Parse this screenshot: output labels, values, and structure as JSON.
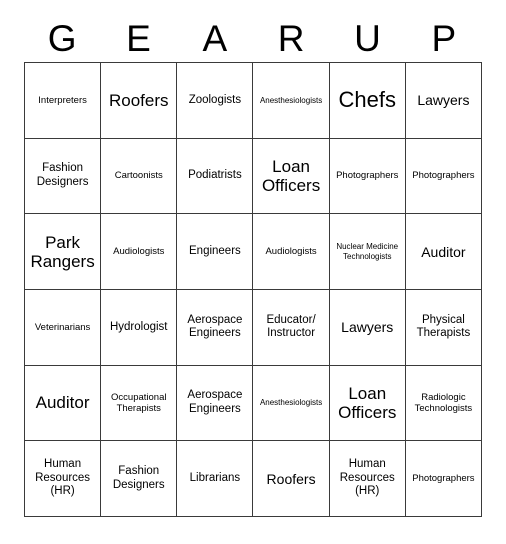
{
  "card": {
    "title": "GEAR UP",
    "header_letters": [
      "G",
      "E",
      "A",
      "R",
      "U",
      "P"
    ],
    "columns": 6,
    "rows": 6,
    "colors": {
      "background": "#ffffff",
      "grid_line": "#3a3a3a",
      "text": "#000000"
    },
    "cells": [
      [
        {
          "label": "Interpreters",
          "size": "sm"
        },
        {
          "label": "Roofers",
          "size": "xl"
        },
        {
          "label": "Zoologists",
          "size": "md"
        },
        {
          "label": "Anesthesiologists",
          "size": "xs"
        },
        {
          "label": "Chefs",
          "size": "xxl"
        },
        {
          "label": "Lawyers",
          "size": "lg"
        }
      ],
      [
        {
          "label": "Fashion Designers",
          "size": "md"
        },
        {
          "label": "Cartoonists",
          "size": "sm"
        },
        {
          "label": "Podiatrists",
          "size": "md"
        },
        {
          "label": "Loan Officers",
          "size": "xl"
        },
        {
          "label": "Photographers",
          "size": "sm"
        },
        {
          "label": "Photographers",
          "size": "sm"
        }
      ],
      [
        {
          "label": "Park Rangers",
          "size": "xl"
        },
        {
          "label": "Audiologists",
          "size": "sm"
        },
        {
          "label": "Engineers",
          "size": "md"
        },
        {
          "label": "Audiologists",
          "size": "sm"
        },
        {
          "label": "Nuclear Medicine Technologists",
          "size": "xs"
        },
        {
          "label": "Auditor",
          "size": "lg"
        }
      ],
      [
        {
          "label": "Veterinarians",
          "size": "sm"
        },
        {
          "label": "Hydrologist",
          "size": "md"
        },
        {
          "label": "Aerospace Engineers",
          "size": "md"
        },
        {
          "label": "Educator/ Instructor",
          "size": "md"
        },
        {
          "label": "Lawyers",
          "size": "lg"
        },
        {
          "label": "Physical Therapists",
          "size": "md"
        }
      ],
      [
        {
          "label": "Auditor",
          "size": "xl"
        },
        {
          "label": "Occupational Therapists",
          "size": "sm"
        },
        {
          "label": "Aerospace Engineers",
          "size": "md"
        },
        {
          "label": "Anesthesiologists",
          "size": "xs"
        },
        {
          "label": "Loan Officers",
          "size": "xl"
        },
        {
          "label": "Radiologic Technologists",
          "size": "sm"
        }
      ],
      [
        {
          "label": "Human Resources (HR)",
          "size": "md"
        },
        {
          "label": "Fashion Designers",
          "size": "md"
        },
        {
          "label": "Librarians",
          "size": "md"
        },
        {
          "label": "Roofers",
          "size": "lg"
        },
        {
          "label": "Human Resources (HR)",
          "size": "md"
        },
        {
          "label": "Photographers",
          "size": "sm"
        }
      ]
    ]
  }
}
